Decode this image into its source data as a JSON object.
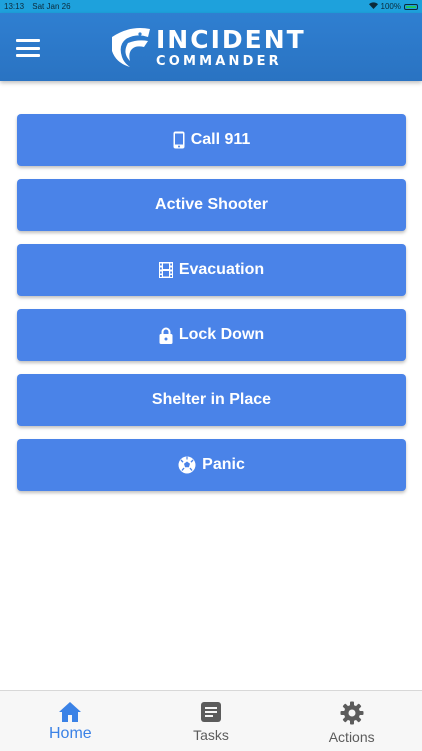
{
  "status_bar": {
    "time": "13:13",
    "date": "Sat Jan 26",
    "battery": "100%"
  },
  "header": {
    "logo_line1": "INCIDENT",
    "logo_line2": "COMMANDER",
    "menu_icon": "hamburger-menu-icon"
  },
  "actions": [
    {
      "label": "Call 911",
      "icon": "mobile-phone-icon"
    },
    {
      "label": "Active Shooter",
      "icon": ""
    },
    {
      "label": "Evacuation",
      "icon": "film-icon"
    },
    {
      "label": "Lock Down",
      "icon": "lock-icon"
    },
    {
      "label": "Shelter in Place",
      "icon": ""
    },
    {
      "label": "Panic",
      "icon": "soccer-ball-icon"
    }
  ],
  "tabs": [
    {
      "label": "Home",
      "icon": "home-icon",
      "active": true
    },
    {
      "label": "Tasks",
      "icon": "list-icon",
      "active": false
    },
    {
      "label": "Actions",
      "icon": "gear-icon",
      "active": false
    }
  ],
  "colors": {
    "status_bar": "#1ea1dc",
    "header": "#2f7fd1",
    "button": "#4a83e8",
    "tab_active": "#3b82e6",
    "tab_inactive": "#5c5c5c"
  }
}
